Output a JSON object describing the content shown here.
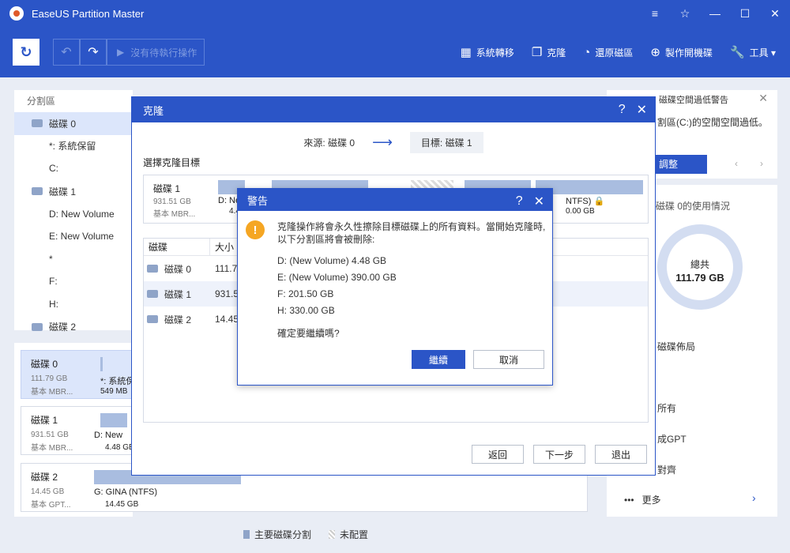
{
  "app": {
    "title": "EaseUS Partition Master",
    "window_controls": [
      "≡",
      "☆",
      "—",
      "☐",
      "✕"
    ]
  },
  "toolbar": {
    "pending_label": "沒有待執行操作",
    "items": [
      {
        "icon": "windows-icon",
        "label": "系統轉移"
      },
      {
        "icon": "clone-icon",
        "label": "克隆"
      },
      {
        "icon": "restore-icon",
        "label": "還原磁區"
      },
      {
        "icon": "plus-circle-icon",
        "label": "製作開機碟"
      },
      {
        "icon": "wrench-icon",
        "label": "工具 ▾"
      }
    ]
  },
  "left_panel": {
    "header": "分割區",
    "tree": [
      {
        "type": "disk",
        "label": "磁碟 0",
        "selected": true
      },
      {
        "type": "part",
        "label": "*: 系統保留"
      },
      {
        "type": "part",
        "label": "C:"
      },
      {
        "type": "disk",
        "label": "磁碟 1"
      },
      {
        "type": "part",
        "label": "D: New Volume"
      },
      {
        "type": "part",
        "label": "E: New Volume"
      },
      {
        "type": "part",
        "label": "*"
      },
      {
        "type": "part",
        "label": "F:"
      },
      {
        "type": "part",
        "label": "H:"
      },
      {
        "type": "disk",
        "label": "磁碟 2"
      }
    ]
  },
  "disk_map": [
    {
      "name": "磁碟 0",
      "size": "111.79 GB",
      "type": "基本 MBR...",
      "part_label": "*: 系統保",
      "part_size": "549 MB"
    },
    {
      "name": "磁碟 1",
      "size": "931.51 GB",
      "type": "基本 MBR...",
      "part_label": "D: New",
      "part_size": "4.48 GB"
    },
    {
      "name": "磁碟 2",
      "size": "14.45 GB",
      "type": "基本 GPT...",
      "part_label": "G: GINA (NTFS)",
      "part_size": "14.45 GB"
    }
  ],
  "legend": {
    "primary": "主要磁碟分割",
    "unallocated": "未配置"
  },
  "right_panel": {
    "warn_title": "磁碟空間過低警告",
    "warn_text": "割區(C:)的空閒空間過低。",
    "warn_button": "調整",
    "usage_title": "磁碟 0的使用情況",
    "donut_label": "總共",
    "donut_value": "111.79 GB",
    "layout_label": "磁碟佈局",
    "action_1": "所有",
    "action_2": "成GPT",
    "action_3": "對齊",
    "more": "更多"
  },
  "clone_dialog": {
    "title": "克隆",
    "source": "來源: 磁碟 0",
    "target": "目標: 磁碟 1",
    "select_label": "選擇克隆目標",
    "strip": {
      "name": "磁碟 1",
      "size": "931.51 GB",
      "type": "基本 MBR...",
      "p1_label": "D: Ne",
      "p1_size": "4.4",
      "p2_label": "NTFS)",
      "p2_size": "0.00 GB"
    },
    "table_headers": [
      "磁碟",
      "大小"
    ],
    "rows": [
      {
        "disk": "磁碟 0",
        "size": "111.79"
      },
      {
        "disk": "磁碟 1",
        "size": "931.51",
        "selected": true
      },
      {
        "disk": "磁碟 2",
        "size": "14.45"
      }
    ],
    "buttons": {
      "back": "返回",
      "next": "下一步",
      "exit": "退出"
    }
  },
  "warning_dialog": {
    "title": "警告",
    "message": "克隆操作將會永久性擦除目標磁碟上的所有資料。當開始克隆時,以下分割區將會被刪除:",
    "items": [
      "D: (New Volume) 4.48 GB",
      "E: (New Volume) 390.00 GB",
      "F: 201.50 GB",
      "H: 330.00 GB"
    ],
    "confirm": "確定要繼續嗎?",
    "continue": "繼續",
    "cancel": "取消"
  }
}
